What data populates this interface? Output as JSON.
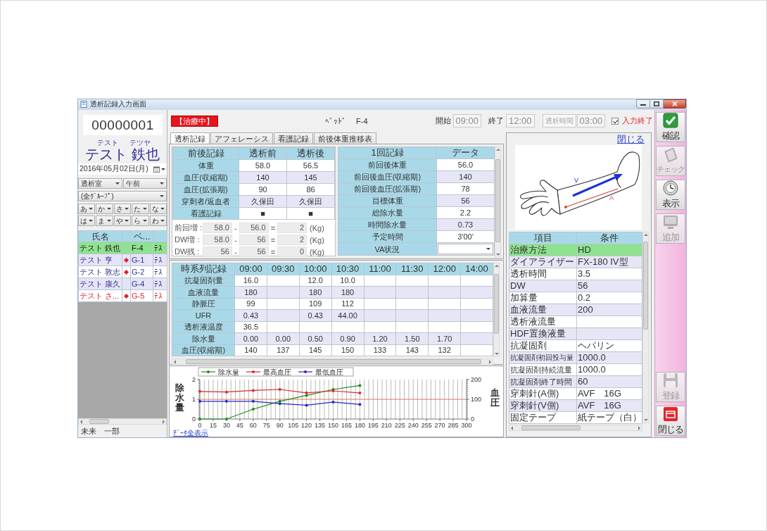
{
  "window": {
    "title": "透析記録入力画面"
  },
  "patient": {
    "id": "00000001",
    "ruby": [
      "テスト",
      "テツヤ"
    ],
    "name": "テスト 鉄也",
    "date": "2016年05月02日(月)"
  },
  "filters": {
    "room": "透析室",
    "session": "午前",
    "group": "(全ｸﾞﾙｰﾌﾟ)",
    "kana": [
      "あ",
      "か",
      "さ",
      "た",
      "な",
      "は",
      "ま",
      "や",
      "ら",
      "わ"
    ]
  },
  "patient_list": {
    "columns": {
      "column_1": "氏名",
      "column_3": "ベ..."
    },
    "rows": [
      {
        "name": "テスト 鉄也",
        "marked": false,
        "column_3": "F-4",
        "column_4": "ﾃｽ",
        "selected": true,
        "alert": false
      },
      {
        "name": "テスト 亨",
        "marked": true,
        "column_3": "G-1",
        "column_4": "ﾃｽ",
        "selected": false,
        "alert": false
      },
      {
        "name": "テスト 敦志",
        "marked": true,
        "column_3": "G-2",
        "column_4": "ﾃｽ",
        "selected": false,
        "alert": false
      },
      {
        "name": "テスト 康久",
        "marked": false,
        "column_3": "G-4",
        "column_4": "ﾃｽ",
        "selected": false,
        "alert": false
      },
      {
        "name": "テスト さ...",
        "marked": true,
        "column_3": "G-5",
        "column_4": "ﾃｽ",
        "selected": false,
        "alert": true
      }
    ]
  },
  "footer": "未来　一部",
  "top_bar": {
    "status": "【治療中】",
    "bed_label": "ﾍﾞｯﾄﾞ",
    "bed": "F-4",
    "start_label": "開始",
    "start": "09:00",
    "end_label": "終了",
    "end": "12:00",
    "duration_label": "透析時間",
    "duration": "03:00",
    "input_done": {
      "label": "入力終了",
      "checked": true
    }
  },
  "tabs": [
    {
      "label": "透析記録",
      "selected": true
    },
    {
      "label": "アフェレーシス",
      "selected": false
    },
    {
      "label": "看護記録",
      "selected": false
    },
    {
      "label": "前後体重推移表",
      "selected": false
    }
  ],
  "pre_post": {
    "columns": [
      "前後記録",
      "透析前",
      "透析後"
    ],
    "rows": [
      [
        "体重",
        "58.0",
        "56.5"
      ],
      [
        "血圧(収縮期)",
        "140",
        "145"
      ],
      [
        "血圧(拡張期)",
        "90",
        "86"
      ],
      [
        "穿刺者/返血者",
        "久保田",
        "久保田"
      ],
      [
        "看護記録",
        "■",
        "■"
      ]
    ]
  },
  "weight_calcs": [
    {
      "label": "前回増 :",
      "a": "58.0",
      "op1": "-",
      "b": "56.0",
      "op2": "=",
      "result": "2",
      "unit": "(Kg)"
    },
    {
      "label": "DW増 :",
      "a": "58.0",
      "op1": "-",
      "b": "56",
      "op2": "=",
      "result": "2",
      "unit": "(Kg)"
    },
    {
      "label": "DW残 :",
      "a": "56",
      "op1": "-",
      "b": "56",
      "op2": "=",
      "result": "0",
      "unit": "(Kg)"
    }
  ],
  "session_record": {
    "columns": [
      "1回記録",
      "データ"
    ],
    "rows": [
      {
        "label": "前回後体重",
        "kind": "text",
        "value": "56.0"
      },
      {
        "label": "前回後血圧(収縮期)",
        "kind": "text",
        "value": "140"
      },
      {
        "label": "前回後血圧(拡張期)",
        "kind": "text",
        "value": "78"
      },
      {
        "label": "目標体重",
        "kind": "text",
        "value": "56"
      },
      {
        "label": "総除水量",
        "kind": "text",
        "value": "2.2"
      },
      {
        "label": "時間除水量",
        "kind": "text",
        "value": "0.73"
      },
      {
        "label": "予定時間",
        "kind": "text",
        "value": "3'00'"
      },
      {
        "label": "VA状況",
        "kind": "dropdown"
      }
    ]
  },
  "time_series": {
    "columns": [
      "時系列記録",
      "09:00",
      "09:30",
      "10:00",
      "10:30",
      "11:00",
      "11:30",
      "12:00",
      "14:00"
    ],
    "rows": [
      {
        "label": "抗凝固剤量",
        "values": {
          "column_2": "16.0",
          "column_4": "12.0",
          "column_5": "10.0"
        }
      },
      {
        "label": "血液流量",
        "values": {
          "column_2": "180",
          "column_4": "180",
          "column_5": "180"
        }
      },
      {
        "label": "静脈圧",
        "values": {
          "column_2": "99",
          "column_4": "109",
          "column_5": "112"
        }
      },
      {
        "label": "UFR",
        "values": {
          "column_2": "0.43",
          "column_4": "0.43",
          "column_5": "44.00"
        }
      },
      {
        "label": "透析液温度",
        "values": {
          "column_2": "36.5"
        }
      },
      {
        "label": "除水量",
        "values": {
          "column_2": "0.00",
          "column_3": "0.00",
          "column_4": "0.50",
          "column_5": "0.90",
          "column_6": "1.20",
          "column_7": "1.50",
          "column_8": "1.70"
        }
      },
      {
        "label": "血圧(収縮期)",
        "values": {
          "column_2": "140",
          "column_3": "137",
          "column_4": "145",
          "column_5": "150",
          "column_6": "133",
          "column_7": "143",
          "column_8": "132"
        }
      }
    ]
  },
  "chart": {
    "chart_data": {
      "type": "line",
      "ylabel": "除水量",
      "y2label": "血圧",
      "x": [
        0,
        30,
        60,
        90,
        120,
        150,
        180
      ],
      "xlim": [
        0,
        300
      ],
      "ylim": [
        0,
        2
      ],
      "y2lim": [
        0,
        200
      ],
      "xticks": [
        0,
        15,
        30,
        45,
        60,
        75,
        90,
        105,
        120,
        135,
        150,
        165,
        180,
        195,
        210,
        225,
        240,
        255,
        270,
        285,
        300
      ],
      "yticks": [
        0,
        1,
        2
      ],
      "y2ticks": [
        0,
        100,
        200
      ],
      "grid": true,
      "legend": "upper left",
      "series": [
        {
          "name": "除水量",
          "color": "#1e8c1e",
          "axis": "y",
          "values": [
            0,
            0,
            0.5,
            0.9,
            1.2,
            1.5,
            1.7
          ]
        },
        {
          "name": "最高血圧",
          "color": "#e02828",
          "axis": "y2",
          "values": [
            140,
            137,
            145,
            150,
            133,
            143,
            132
          ]
        },
        {
          "name": "最低血圧",
          "color": "#2828c8",
          "axis": "y2",
          "values": [
            90,
            90,
            90,
            78,
            70,
            86,
            74
          ]
        }
      ],
      "ref_lines": [
        {
          "axis": "y",
          "value": 1,
          "color": "#d8785a"
        }
      ]
    },
    "link": "ﾃﾞｰﾀ全表示"
  },
  "right_panel": {
    "close_link": "閉じる",
    "arm_labels": {
      "venous": "V",
      "arterial": "A"
    },
    "conditions": {
      "columns": [
        "項目",
        "条件"
      ],
      "rows": [
        {
          "label": "治療方法",
          "value": "HD",
          "selected": true
        },
        {
          "label": "ダイアライザー",
          "value": "FX-180 IV型",
          "selected": false
        },
        {
          "label": "透析時間",
          "value": "3.5",
          "selected": false
        },
        {
          "label": "DW",
          "value": "56",
          "selected": false
        },
        {
          "label": "加算量",
          "value": "0.2",
          "selected": false
        },
        {
          "label": "血液流量",
          "value": "200",
          "selected": false
        },
        {
          "label": "透析液流量",
          "selected": false
        },
        {
          "label": "HDF置換液量",
          "selected": false
        },
        {
          "label": "抗凝固剤",
          "value": "ヘパリン",
          "selected": false
        },
        {
          "label": "抗凝固剤初回投与量",
          "value": "1000.0",
          "selected": false
        },
        {
          "label": "抗凝固剤持続流量",
          "value": "1000.0",
          "selected": false
        },
        {
          "label": "抗凝固剤終了時間",
          "value": "60",
          "selected": false
        },
        {
          "label": "穿刺針(A側)",
          "value": "AVF　16G",
          "selected": false
        },
        {
          "label": "穿刺針(V側)",
          "value": "AVF　16G",
          "selected": false
        },
        {
          "label": "固定テープ",
          "value": "紙テープ（白）",
          "selected": false
        }
      ]
    }
  },
  "toolbar": {
    "top": [
      {
        "label": "確認",
        "kind": "check",
        "disabled": false
      },
      {
        "label": "チェック",
        "kind": "book",
        "disabled": true
      },
      {
        "label": "表示",
        "kind": "clock",
        "disabled": false
      },
      {
        "label": "追加",
        "kind": "monitor",
        "disabled": true
      }
    ],
    "bottom": [
      {
        "label": "登録",
        "kind": "floppy",
        "disabled": true
      },
      {
        "label": "閉じる",
        "kind": "exit",
        "disabled": false
      }
    ]
  }
}
